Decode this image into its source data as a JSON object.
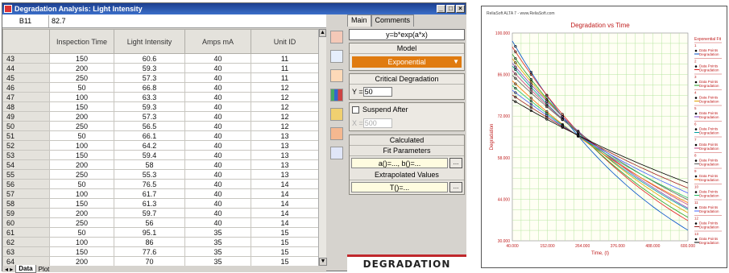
{
  "window": {
    "title": "Degradation Analysis: Light Intensity"
  },
  "formula_bar": {
    "cell_ref": "B11",
    "value": "82.7"
  },
  "columns": [
    "Inspection Time",
    "Light Intensity",
    "Amps mA",
    "Unit ID"
  ],
  "rows": [
    [
      "43",
      "150",
      "60.6",
      "40",
      "11"
    ],
    [
      "44",
      "200",
      "59.3",
      "40",
      "11"
    ],
    [
      "45",
      "250",
      "57.3",
      "40",
      "11"
    ],
    [
      "46",
      "50",
      "66.8",
      "40",
      "12"
    ],
    [
      "47",
      "100",
      "63.3",
      "40",
      "12"
    ],
    [
      "48",
      "150",
      "59.3",
      "40",
      "12"
    ],
    [
      "49",
      "200",
      "57.3",
      "40",
      "12"
    ],
    [
      "50",
      "250",
      "56.5",
      "40",
      "12"
    ],
    [
      "51",
      "50",
      "66.1",
      "40",
      "13"
    ],
    [
      "52",
      "100",
      "64.2",
      "40",
      "13"
    ],
    [
      "53",
      "150",
      "59.4",
      "40",
      "13"
    ],
    [
      "54",
      "200",
      "58",
      "40",
      "13"
    ],
    [
      "55",
      "250",
      "55.3",
      "40",
      "13"
    ],
    [
      "56",
      "50",
      "76.5",
      "40",
      "14"
    ],
    [
      "57",
      "100",
      "61.7",
      "40",
      "14"
    ],
    [
      "58",
      "150",
      "61.3",
      "40",
      "14"
    ],
    [
      "59",
      "200",
      "59.7",
      "40",
      "14"
    ],
    [
      "60",
      "250",
      "56",
      "40",
      "14"
    ],
    [
      "61",
      "50",
      "95.1",
      "35",
      "15"
    ],
    [
      "62",
      "100",
      "86",
      "35",
      "15"
    ],
    [
      "63",
      "150",
      "77.6",
      "35",
      "15"
    ],
    [
      "64",
      "200",
      "70",
      "35",
      "15"
    ]
  ],
  "sheet_tabs": {
    "data": "Data",
    "plot": "Plot"
  },
  "panel": {
    "tab_main": "Main",
    "tab_comments": "Comments",
    "equation": "y=b*exp(a*x)",
    "model_header": "Model",
    "model_value": "Exponential",
    "critical_header": "Critical Degradation",
    "critical_label": "Y =",
    "critical_value": "50",
    "suspend_label": "Suspend After",
    "suspend_x_label": "X =",
    "suspend_value": "500",
    "calculated": "Calculated",
    "fit_header": "Fit Parameters",
    "fit_value": "a()=..., b()=...",
    "extrap_header": "Extrapolated Values",
    "extrap_value": "T()=...",
    "ellipsis": "...",
    "banner": "DEGRADATION"
  },
  "plot": {
    "watermark": "ReliaSoft ALTA 7 - www.ReliaSoft.com",
    "title": "Degradation vs Time",
    "xlabel": "Time, (t)",
    "ylabel": "Degradation",
    "legend_title": "Exponential Fit",
    "legend_items": [
      {
        "id": "1",
        "label": "Data Points",
        "sub": "Degradation"
      },
      {
        "id": "2",
        "label": "Data Points",
        "sub": "Degradation"
      },
      {
        "id": "3",
        "label": "Data Points",
        "sub": "Degradation"
      },
      {
        "id": "4",
        "label": "Data Points",
        "sub": "Degradation"
      },
      {
        "id": "5",
        "label": "Data Points",
        "sub": "Degradation"
      },
      {
        "id": "6",
        "label": "Data Points",
        "sub": "Degradation"
      },
      {
        "id": "7",
        "label": "Data Points",
        "sub": "Degradation"
      },
      {
        "id": "8",
        "label": "Data Points",
        "sub": "Degradation"
      },
      {
        "id": "9",
        "label": "Data Points",
        "sub": "Degradation"
      },
      {
        "id": "10",
        "label": "Data Points",
        "sub": "Degradation"
      },
      {
        "id": "11",
        "label": "Data Points",
        "sub": "Degradation"
      },
      {
        "id": "12",
        "label": "Data Points",
        "sub": "Degradation"
      },
      {
        "id": "13",
        "label": "Data Points",
        "sub": "Degradation"
      }
    ],
    "yticks": [
      "100.000",
      "86.000",
      "72.000",
      "58.000",
      "44.000",
      "30.000"
    ],
    "xticks": [
      "40.000",
      "152.000",
      "264.000",
      "376.000",
      "488.000",
      "600.000"
    ]
  },
  "chart_data": {
    "type": "line",
    "title": "Degradation vs Time",
    "xlabel": "Time, (t)",
    "ylabel": "Degradation",
    "xlim": [
      40,
      600
    ],
    "ylim": [
      30,
      100
    ],
    "grid": true,
    "legend_placement": "right",
    "colors": [
      "#0050c8",
      "#e02020",
      "#20a020",
      "#e0a000",
      "#8040c0",
      "#00a0a0",
      "#c04080",
      "#606060",
      "#ff7000",
      "#20c060",
      "#4060ff",
      "#a02020",
      "#000000"
    ],
    "series": [
      {
        "name": "1",
        "b": 105,
        "a": -0.0019
      },
      {
        "name": "2",
        "b": 102,
        "a": -0.0017
      },
      {
        "name": "3",
        "b": 99,
        "a": -0.0016
      },
      {
        "name": "4",
        "b": 97,
        "a": -0.0015
      },
      {
        "name": "5",
        "b": 95,
        "a": -0.0014
      },
      {
        "name": "6",
        "b": 94,
        "a": -0.0014
      },
      {
        "name": "7",
        "b": 92,
        "a": -0.0013
      },
      {
        "name": "8",
        "b": 90,
        "a": -0.0012
      },
      {
        "name": "9",
        "b": 88,
        "a": -0.0012
      },
      {
        "name": "10",
        "b": 86,
        "a": -0.0011
      },
      {
        "name": "11",
        "b": 84,
        "a": -0.001
      },
      {
        "name": "12",
        "b": 82,
        "a": -0.0009
      },
      {
        "name": "13",
        "b": 80,
        "a": -0.0008
      }
    ]
  }
}
